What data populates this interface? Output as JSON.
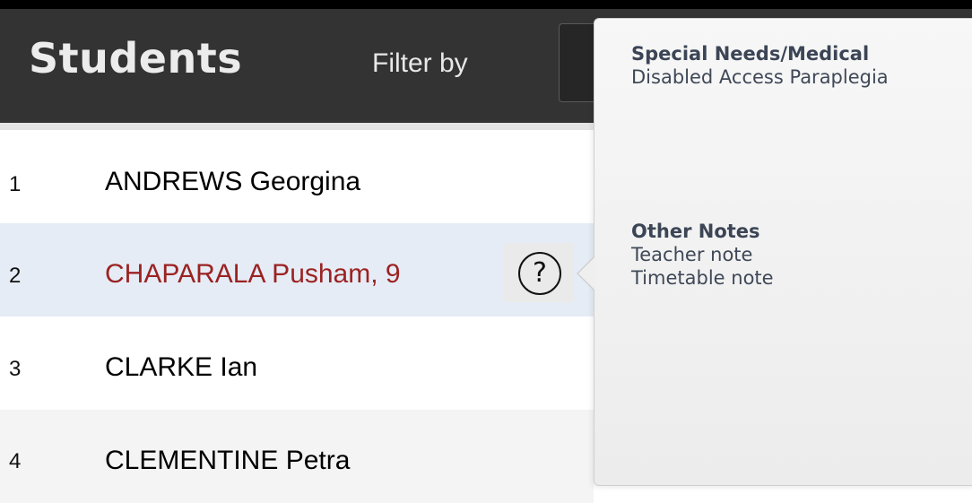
{
  "header": {
    "title": "Students",
    "filter_label": "Filter by"
  },
  "rows": [
    {
      "number": "1",
      "name": "ANDREWS Georgina",
      "highlighted": false
    },
    {
      "number": "2",
      "name": "CHAPARALA Pusham, 9",
      "highlighted": true
    },
    {
      "number": "3",
      "name": "CLARKE Ian",
      "highlighted": false
    },
    {
      "number": "4",
      "name": "CLEMENTINE Petra",
      "highlighted": false
    }
  ],
  "help_button": {
    "icon": "question-mark-icon",
    "glyph": "?"
  },
  "popover": {
    "sections": [
      {
        "heading": "Special Needs/Medical",
        "lines": [
          "Disabled Access Paraplegia"
        ]
      },
      {
        "heading": "Other Notes",
        "lines": [
          "Teacher note",
          "Timetable note"
        ]
      }
    ]
  },
  "colors": {
    "header_bg": "#333333",
    "highlight_name": "#9b2222",
    "highlight_row_bg": "#e6ecf5",
    "alt_row_bg": "#f4f4f4",
    "popover_text": "#3b4555"
  }
}
